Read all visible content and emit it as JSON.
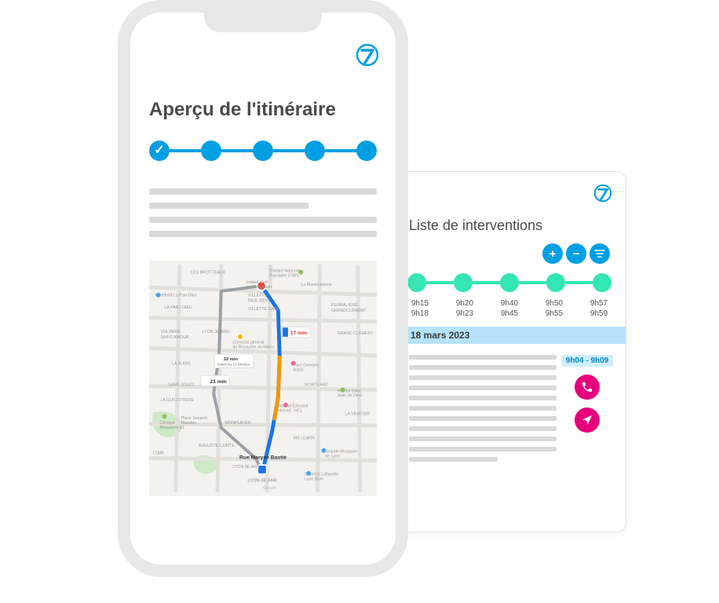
{
  "phone": {
    "title": "Aperçu de l'itinéraire",
    "progress_steps": 5
  },
  "tablet": {
    "title": "Liste de interventions",
    "buttons": {
      "add": "+",
      "remove": "−",
      "filter": "filter-icon"
    },
    "timeline": [
      {
        "start": "9h15",
        "end": "9h18"
      },
      {
        "start": "9h20",
        "end": "9h23"
      },
      {
        "start": "9h40",
        "end": "9h45"
      },
      {
        "start": "9h50",
        "end": "9h55"
      },
      {
        "start": "9h57",
        "end": "9h59"
      }
    ],
    "date": "18 mars 2023",
    "intervention": {
      "time_badge": "9h04 - 9h09"
    }
  },
  "map": {
    "labels": {
      "duration1": "17 min",
      "duration2": "32 min",
      "duration2_sub": "toutes les 15 minutes",
      "duration3": "21 min",
      "end_label": "Rue Maryse Bastié",
      "end_sub": "LYON 8E ARR.",
      "areas": [
        "LES BROTTEAUX",
        "Westfield La Part-Dieu",
        "LA PART-DIEU",
        "VOLTAIRE-SAINT AMOUR",
        "LYON 3E ARR.",
        "LA BUIRE",
        "SANS-SOUCI",
        "LA GUILLOTIÈRE",
        "MONPLAISIR",
        "LYON 8E ARR.",
        "AUGUSTE COMTE",
        "MONTCHAT",
        "PERRALIÈRE GRANDCLÉMENT",
        "GRAND CLÉMENT",
        "LA VINATIER",
        "VILLETTE GARE",
        "VILLETTE PAUL BERT",
        "La Manécanterie",
        "Institut d'art contemporain",
        "Consulat général du Royaume du Maroc",
        "Hôpital Saint Jean de Dieu",
        "Clinique Mutualiste EL",
        "Place Sergent Blandan",
        "LTAM",
        "Hôpital Édouard Herriot - HCL",
        "Parc Georges Bazin",
        "MB LEARN",
        "Galeries Lafayette Lyon Bron",
        "Grande Mosquée de Lyon",
        "Google",
        "Théâtre National Populaire (TNP)"
      ]
    }
  },
  "colors": {
    "brand_blue": "#009fe3",
    "teal": "#33e6b3",
    "magenta": "#e6007e",
    "light_blue": "#b4e3f9"
  }
}
